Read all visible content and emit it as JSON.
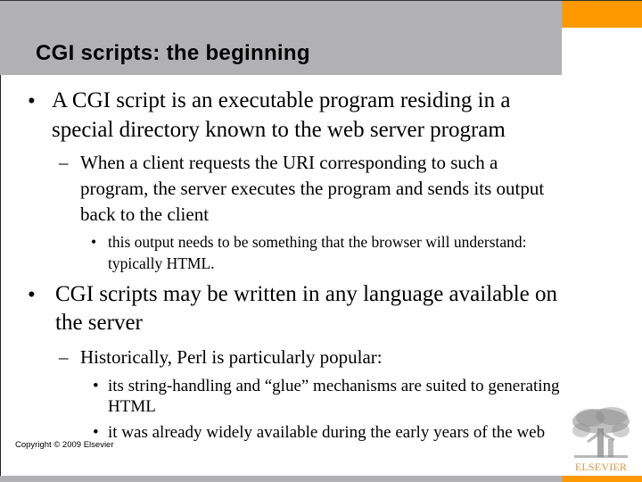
{
  "slide": {
    "title": "CGI scripts: the beginning",
    "bullets": [
      {
        "marker": "•",
        "lines": [
          "A CGI script is an executable program residing in a",
          "special directory known to the web server program"
        ]
      },
      {
        "marker": "–",
        "lines": [
          "When a client requests the URI corresponding to such a",
          "program, the server executes the program and sends its output",
          "back to the client"
        ]
      },
      {
        "marker": "•",
        "lines": [
          "this output needs to be something that the browser will understand:",
          "typically HTML."
        ]
      },
      {
        "marker": "•",
        "lines": [
          "CGI scripts may be written in any language available on",
          "the server"
        ]
      },
      {
        "marker": "–",
        "lines": [
          "Historically, Perl is particularly popular:"
        ]
      },
      {
        "marker": "•",
        "lines": [
          "its string-handling and “glue” mechanisms are suited to generating",
          "HTML"
        ]
      },
      {
        "marker": "•",
        "lines": [
          "it was already widely available during the early years of the web"
        ]
      }
    ],
    "copyright": "Copyright © 2009 Elsevier",
    "logo": {
      "icon": "elsevier-tree-icon",
      "text": "ELSEVIER"
    }
  },
  "colors": {
    "title_bar": "#b1b1b3",
    "accent": "#ff9900",
    "logo_text": "#d8973a"
  }
}
